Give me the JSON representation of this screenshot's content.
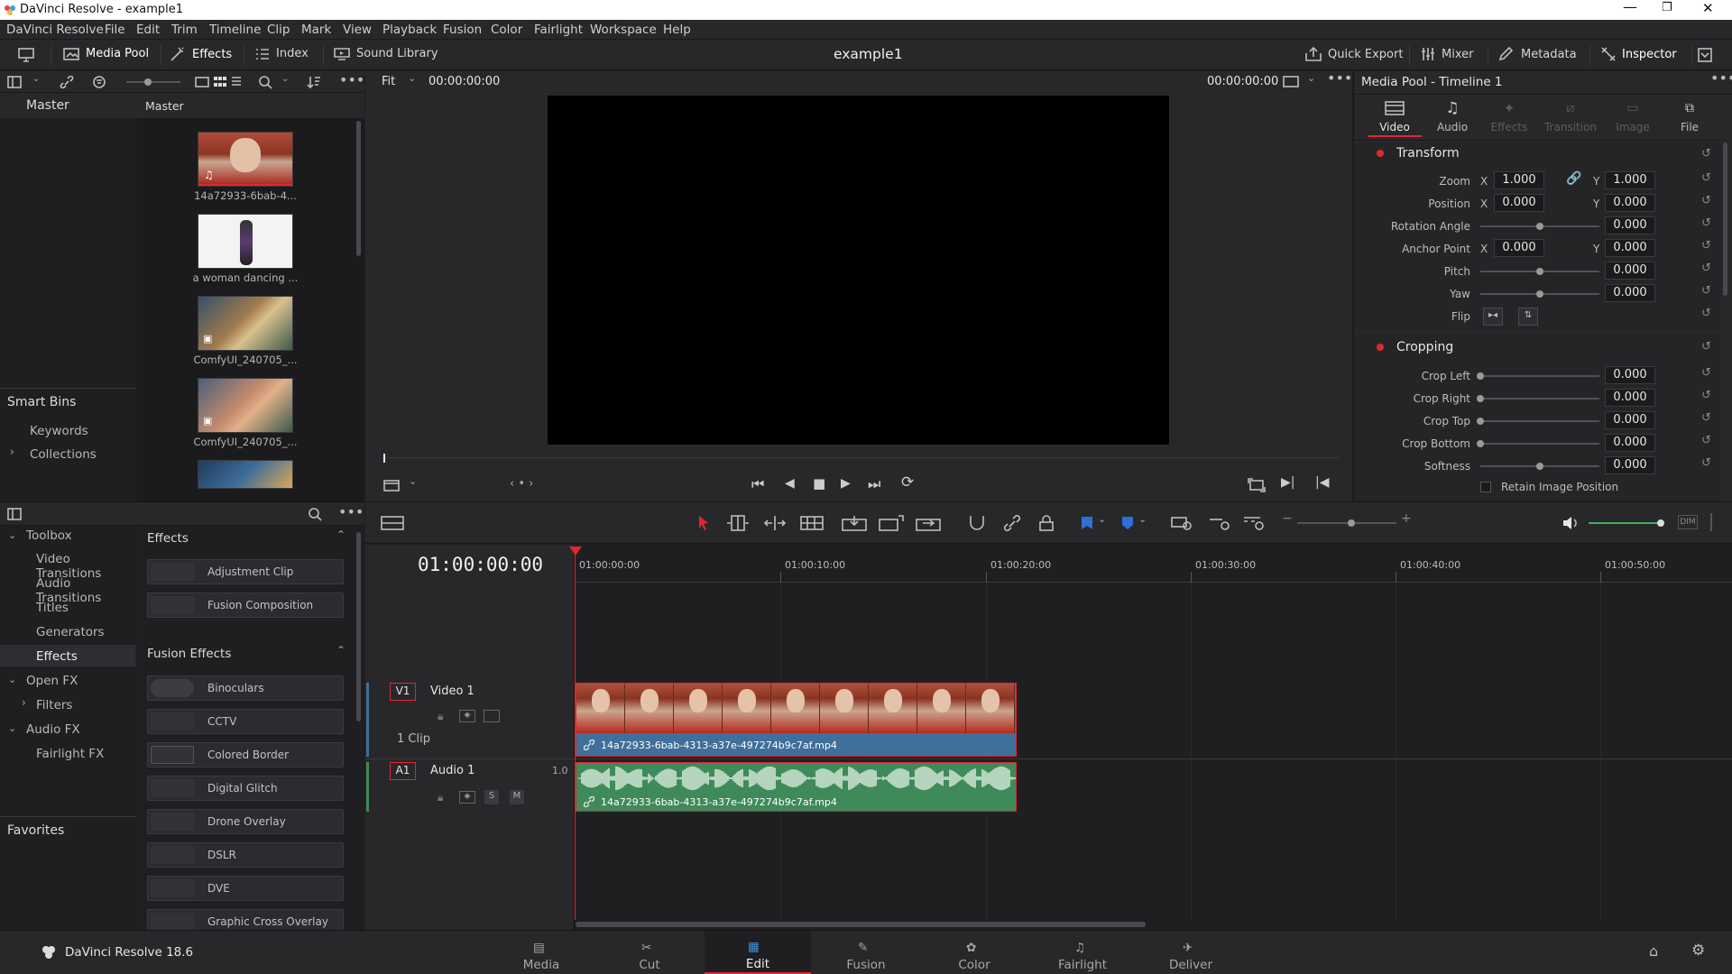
{
  "window": {
    "title": "DaVinci Resolve - example1"
  },
  "menu": [
    "DaVinci Resolve",
    "File",
    "Edit",
    "Trim",
    "Timeline",
    "Clip",
    "Mark",
    "View",
    "Playback",
    "Fusion",
    "Color",
    "Fairlight",
    "Workspace",
    "Help"
  ],
  "toolbar": {
    "media_pool": "Media Pool",
    "effects": "Effects",
    "index": "Index",
    "sound_library": "Sound Library",
    "project_name": "example1",
    "quick_export": "Quick Export",
    "mixer": "Mixer",
    "metadata": "Metadata",
    "inspector": "Inspector"
  },
  "media_pool": {
    "bins_header": "Master",
    "clips_header": "Master",
    "clips": [
      {
        "name": "14a72933-6bab-4..."
      },
      {
        "name": "a woman dancing ..."
      },
      {
        "name": "ComfyUI_240705_..."
      },
      {
        "name": "ComfyUI_240705_..."
      }
    ],
    "smart_bins": "Smart Bins",
    "smart_items": [
      "Keywords",
      "Collections"
    ]
  },
  "viewer": {
    "fit": "Fit",
    "timecode_left": "00:00:00:00",
    "timecode_right": "00:00:00:00"
  },
  "inspector": {
    "title": "Media Pool - Timeline 1",
    "tabs": [
      "Video",
      "Audio",
      "Effects",
      "Transition",
      "Image",
      "File"
    ],
    "transform": {
      "label": "Transform",
      "zoom": {
        "label": "Zoom",
        "x": "1.000",
        "y": "1.000"
      },
      "position": {
        "label": "Position",
        "x": "0.000",
        "y": "0.000"
      },
      "rotation": {
        "label": "Rotation Angle",
        "value": "0.000"
      },
      "anchor": {
        "label": "Anchor Point",
        "x": "0.000",
        "y": "0.000"
      },
      "pitch": {
        "label": "Pitch",
        "value": "0.000"
      },
      "yaw": {
        "label": "Yaw",
        "value": "0.000"
      },
      "flip": {
        "label": "Flip"
      },
      "x_label": "X",
      "y_label": "Y"
    },
    "cropping": {
      "label": "Cropping",
      "left": {
        "label": "Crop Left",
        "value": "0.000"
      },
      "right": {
        "label": "Crop Right",
        "value": "0.000"
      },
      "top": {
        "label": "Crop Top",
        "value": "0.000"
      },
      "bottom": {
        "label": "Crop Bottom",
        "value": "0.000"
      },
      "softness": {
        "label": "Softness",
        "value": "0.000"
      },
      "retain": "Retain Image Position"
    }
  },
  "effects_panel": {
    "tree": {
      "toolbox": "Toolbox",
      "toolbox_items": [
        "Video Transitions",
        "Audio Transitions",
        "Titles",
        "Generators",
        "Effects"
      ],
      "openfx": "Open FX",
      "filters": "Filters",
      "audiofx": "Audio FX",
      "fairlight_fx": "Fairlight FX",
      "favorites": "Favorites"
    },
    "effects_header": "Effects",
    "effects_items": [
      "Adjustment Clip",
      "Fusion Composition"
    ],
    "fusion_header": "Fusion Effects",
    "fusion_items": [
      "Binoculars",
      "CCTV",
      "Colored Border",
      "Digital Glitch",
      "Drone Overlay",
      "DSLR",
      "DVE",
      "Graphic Cross Overlay"
    ]
  },
  "timeline": {
    "timecode": "01:00:00:00",
    "ruler": [
      "01:00:00:00",
      "01:00:10:00",
      "01:00:20:00",
      "01:00:30:00",
      "01:00:40:00",
      "01:00:50:00"
    ],
    "v1": {
      "badge": "V1",
      "name": "Video 1",
      "clips": "1 Clip"
    },
    "a1": {
      "badge": "A1",
      "name": "Audio 1",
      "level": "1.0",
      "solo": "S",
      "mute": "M"
    },
    "video_clip": "14a72933-6bab-4313-a37e-497274b9c7af.mp4",
    "audio_clip": "14a72933-6bab-4313-a37e-497274b9c7af.mp4"
  },
  "pages": {
    "app_version": "DaVinci Resolve 18.6",
    "items": [
      "Media",
      "Cut",
      "Edit",
      "Fusion",
      "Color",
      "Fairlight",
      "Deliver"
    ],
    "active": "Edit"
  },
  "colors": {
    "accent_red": "#e0262f",
    "video_clip": "#3f6f9a",
    "audio_clip": "#3f8a5a",
    "panel": "#28282b"
  }
}
